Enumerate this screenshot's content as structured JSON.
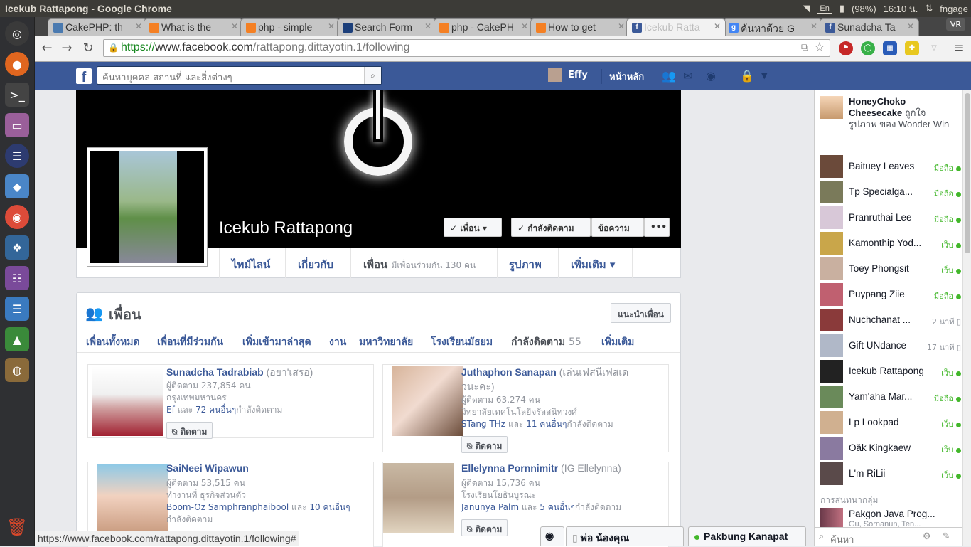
{
  "window": {
    "title": "Icekub Rattapong - Google Chrome"
  },
  "tray": {
    "lang": "En",
    "battery": "(98%)",
    "clock": "16:10 น.",
    "user": "fngage"
  },
  "tabs": [
    {
      "label": "CakePHP: th",
      "color": "#4a7ab0"
    },
    {
      "label": "What is the",
      "color": "#f48024"
    },
    {
      "label": "php - simple",
      "color": "#f48024"
    },
    {
      "label": "Search Form",
      "color": "#1c3f7a"
    },
    {
      "label": "php - CakePH",
      "color": "#f48024"
    },
    {
      "label": "How to get",
      "color": "#f48024"
    },
    {
      "label": "Icekub Ratta",
      "color": "#3b5998"
    },
    {
      "label": "ค้นหาด้วย G",
      "color": "#4285f4"
    },
    {
      "label": "Sunadcha Ta",
      "color": "#3b5998"
    }
  ],
  "vr_label": "VR",
  "url": {
    "scheme": "https://",
    "host": "www.facebook.com",
    "path": "/rattapong.dittayotin.1/following"
  },
  "fb": {
    "search_placeholder": "ค้นหาบุคคล สถานที่ และสิ่งต่างๆ",
    "user_name": "Effy",
    "home": "หน้าหลัก"
  },
  "profile": {
    "name": "Icekub Rattapong",
    "friend_btn": "✓ เพื่อน ▾",
    "following_btn": "✓ กำลังติดตาม",
    "message_btn": "ข้อความ",
    "more_btn": "•••",
    "nav": {
      "timeline": "ไทม์ไลน์",
      "about": "เกี่ยวกับ",
      "friends": "เพื่อน",
      "mutual": "มีเพื่อนร่วมกัน 130 คน",
      "photos": "รูปภาพ",
      "more": "เพิ่มเติม ▾"
    }
  },
  "friends": {
    "title": "เพื่อน",
    "suggest_btn": "แนะนำเพื่อน",
    "subtabs": {
      "all": "เพื่อนทั้งหมด",
      "mutual": "เพื่อนที่มีร่วมกัน",
      "recent": "เพิ่มเข้ามาล่าสุด",
      "work": "งาน",
      "university": "มหาวิทยาลัย",
      "highschool": "โรงเรียนมัธยม",
      "following": "กำลังติดตาม",
      "following_count": "55",
      "more": "เพิ่มเติม"
    },
    "follow_btn": "⍉ ติดตาม",
    "cards": [
      {
        "name": "Sunadcha Tadrabiab",
        "alias": "(อยา'เสรอ)",
        "l1": "ผู้ติดตาม 237,854 คน",
        "l2": "กรุงเทพมหานคร",
        "l3a": "Ef",
        "l3b": "และ",
        "l3c": "72 คนอื่นๆ",
        "l3d": "กำลังติดตาม"
      },
      {
        "name": "Juthaphon Sanapan",
        "alias": "(เล่นเฟสนีเฟสเด",
        "alias2": "วนะคะ)",
        "l1": "ผู้ติดตาม 63,274 คน",
        "l2": "วิทยาลัยเทคโนโลยีจรัลสนิทวงศ์",
        "l3a": "STang THz",
        "l3b": "และ",
        "l3c": "11 คนอื่นๆ",
        "l3d": "กำลังติดตาม"
      },
      {
        "name": "SaiNeei Wipawun",
        "alias": "",
        "l1": "ผู้ติดตาม 53,515 คน",
        "l2": "ทำงานที่ ธุรกิจส่วนตัว",
        "l3a": "Boom-Oz Samphranphaibool",
        "l3b": "และ",
        "l3c": "10 คนอื่นๆ",
        "l3d": "กำลังติดตาม"
      },
      {
        "name": "Ellelynna Pornnimitr",
        "alias": "(IG Ellelynna)",
        "l1": "ผู้ติดตาม 15,736 คน",
        "l2": "โรงเรียนโยธินบูรณะ",
        "l3a": "Janunya Palm",
        "l3b": "และ",
        "l3c": "5 คนอื่นๆ",
        "l3d": "กำลังติดตาม"
      }
    ]
  },
  "ticker": {
    "name": "HoneyChoko Cheesecake",
    "rest": "ถูกใจรูปภาพ ของ Wonder Win"
  },
  "chat": [
    {
      "name": "Baituey Leaves",
      "status": "มือถือ",
      "online": true,
      "color": "#6b4a3a"
    },
    {
      "name": "Tp Specialga...",
      "status": "มือถือ",
      "online": true,
      "color": "#7a7a5a"
    },
    {
      "name": "Pranruthai Lee",
      "status": "มือถือ",
      "online": true,
      "color": "#d8c8d8"
    },
    {
      "name": "Kamonthip Yod...",
      "status": "เว็บ",
      "online": true,
      "color": "#c9a64a"
    },
    {
      "name": "Toey Phongsit",
      "status": "เว็บ",
      "online": true,
      "color": "#c9b0a0"
    },
    {
      "name": "Puypang Ziie",
      "status": "มือถือ",
      "online": true,
      "color": "#c06070"
    },
    {
      "name": "Nuchchanat ...",
      "status": "2 นาที ▯",
      "online": false,
      "color": "#8a3a3a"
    },
    {
      "name": "Gift UNdance",
      "status": "17 นาที ▯",
      "online": false,
      "color": "#b0b8c8"
    },
    {
      "name": "Icekub Rattapong",
      "status": "เว็บ",
      "online": true,
      "color": "#222222"
    },
    {
      "name": "Yam'aha Mar...",
      "status": "มือถือ",
      "online": true,
      "color": "#6a8a5a"
    },
    {
      "name": "Lp Lookpad",
      "status": "เว็บ",
      "online": true,
      "color": "#d0b090"
    },
    {
      "name": "Oäk Kingkaew",
      "status": "เว็บ",
      "online": true,
      "color": "#8a7aa0"
    },
    {
      "name": "L'm RiLii",
      "status": "เว็บ",
      "online": true,
      "color": "#5a4a4a"
    }
  ],
  "groups_title": "การสนทนากลุ่ม",
  "group": {
    "name": "Pakgon Java Prog...",
    "sub": "Gu, Sornanun, Ten..."
  },
  "chat_search": "ค้นหา",
  "status_url": "https://www.facebook.com/rattapong.dittayotin.1/following#",
  "chat_tabs": {
    "t1": "พ่อ น้องคุณ",
    "t2": "Pakbung Kanapat"
  }
}
